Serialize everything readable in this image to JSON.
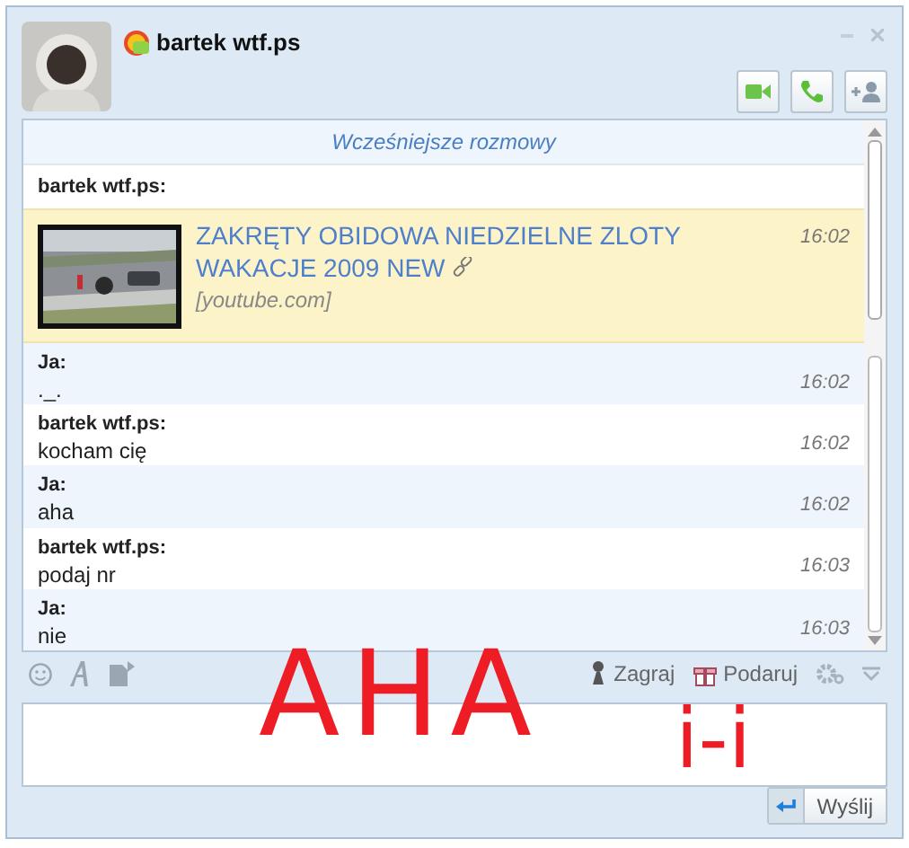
{
  "window": {
    "title": "bartek wtf.ps"
  },
  "header_buttons": [
    {
      "kind": "video"
    },
    {
      "kind": "call"
    },
    {
      "kind": "add-contact"
    }
  ],
  "history_link": "Wcześniejsze rozmowy",
  "messages": [
    {
      "kind": "link",
      "outgoing": false,
      "sender": "bartek wtf.ps:",
      "title": "ZAKRĘTY OBIDOWA NIEDZIELNE ZLOTY WAKACJE 2009 NEW",
      "source": "[youtube.com]",
      "time": "16:02"
    },
    {
      "kind": "text",
      "outgoing": true,
      "sender": "Ja:",
      "text": "._.",
      "time": "16:02"
    },
    {
      "kind": "text",
      "outgoing": false,
      "sender": "bartek wtf.ps:",
      "text": "kocham cię",
      "time": "16:02"
    },
    {
      "kind": "text",
      "outgoing": true,
      "sender": "Ja:",
      "text": "aha",
      "time": "16:02"
    },
    {
      "kind": "text",
      "outgoing": false,
      "sender": "bartek wtf.ps:",
      "text": "podaj nr",
      "time": "16:03"
    },
    {
      "kind": "text",
      "outgoing": true,
      "sender": "Ja:",
      "text": "nie",
      "time": "16:03"
    }
  ],
  "toolbar": {
    "play": "Zagraj",
    "gift": "Podaruj"
  },
  "send_button": "Wyślij",
  "scribble": [
    "AHA",
    "i-i"
  ]
}
